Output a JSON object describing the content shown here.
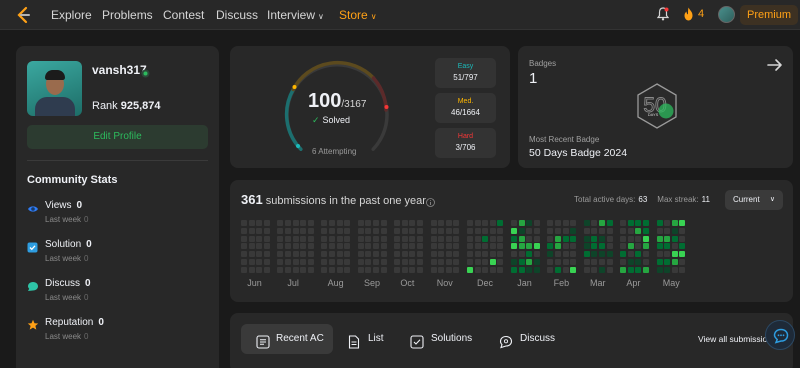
{
  "nav": {
    "items": [
      {
        "label": "Explore"
      },
      {
        "label": "Problems"
      },
      {
        "label": "Contest"
      },
      {
        "label": "Discuss"
      },
      {
        "label": "Interview"
      },
      {
        "label": "Store"
      }
    ],
    "streak_count": "4",
    "premium_label": "Premium",
    "colors": {
      "accent": "#ffa116",
      "bg": "#282828"
    }
  },
  "profile": {
    "username": "vansh317",
    "rank_label": "Rank",
    "rank_value": "925,874",
    "edit_label": "Edit Profile",
    "community_title": "Community Stats",
    "stats": [
      {
        "label": "Views",
        "value": "0",
        "sub_label": "Last week",
        "sub_value": "0",
        "icon": "eye-icon"
      },
      {
        "label": "Solution",
        "value": "0",
        "sub_label": "Last week",
        "sub_value": "0",
        "icon": "checkbox-icon"
      },
      {
        "label": "Discuss",
        "value": "0",
        "sub_label": "Last week",
        "sub_value": "0",
        "icon": "chat-icon"
      },
      {
        "label": "Reputation",
        "value": "0",
        "sub_label": "Last week",
        "sub_value": "0",
        "icon": "star-icon"
      }
    ]
  },
  "solved": {
    "count": "100",
    "total": "/3167",
    "solved_label": "Solved",
    "attempting": "6 Attempting",
    "difficulties": [
      {
        "label": "Easy",
        "value": "51/797",
        "color": "#1cbaba"
      },
      {
        "label": "Med.",
        "value": "46/1664",
        "color": "#ffb700"
      },
      {
        "label": "Hard",
        "value": "3/706",
        "color": "#f63737"
      }
    ]
  },
  "badges": {
    "title": "Badges",
    "count": "1",
    "recent_label": "Most Recent Badge",
    "recent_name": "50 Days Badge 2024",
    "badge_text": "DAYS"
  },
  "submissions": {
    "count": "361",
    "title_rest": "submissions in the past one year",
    "active_label": "Total active days:",
    "active_value": "63",
    "streak_label": "Max streak:",
    "streak_value": "11",
    "period": "Current",
    "months": [
      "Jun",
      "Jul",
      "Aug",
      "Sep",
      "Oct",
      "Nov",
      "Dec",
      "Jan",
      "Feb",
      "Mar",
      "Apr",
      "May"
    ]
  },
  "tabs": {
    "items": [
      {
        "label": "Recent AC",
        "icon": "list-icon"
      },
      {
        "label": "List",
        "icon": "document-icon"
      },
      {
        "label": "Solutions",
        "icon": "checkbox-icon"
      },
      {
        "label": "Discuss",
        "icon": "chat-icon"
      }
    ],
    "view_all": "View all submissio"
  }
}
